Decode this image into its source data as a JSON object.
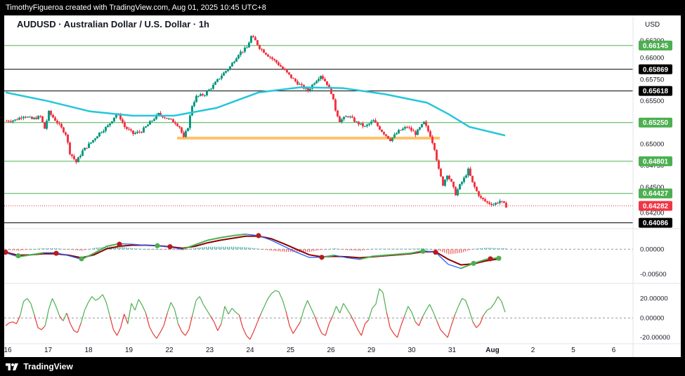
{
  "header": {
    "credit": "TimothyFigueroa created with TradingView.com, Aug 01, 2025 10:45 UTC+8"
  },
  "footer": {
    "brand": "TradingView"
  },
  "chart_data": {
    "type": "candlestick",
    "title": "AUDUSD · Australian Dollar / U.S. Dollar · 1h",
    "currency": "USD",
    "x_tick_labels": [
      "16",
      "17",
      "18",
      "19",
      "22",
      "23",
      "24",
      "25",
      "26",
      "29",
      "30",
      "31",
      "Aug",
      "2",
      "5",
      "6"
    ],
    "price_axis": {
      "labels": [
        "0.66200",
        "0.66000",
        "0.65750",
        "0.65500",
        "0.65250",
        "0.65000",
        "0.64750",
        "0.64500",
        "0.64200"
      ],
      "ylim": [
        0.6405,
        0.6625
      ]
    },
    "levels": [
      {
        "value": 0.66145,
        "label": "0.66145",
        "color": "#4caf50"
      },
      {
        "value": 0.65869,
        "label": "0.65869",
        "color": "#000000"
      },
      {
        "value": 0.65618,
        "label": "0.65618",
        "color": "#000000"
      },
      {
        "value": 0.6525,
        "label": "0.65250",
        "color": "#4caf50"
      },
      {
        "value": 0.64801,
        "label": "0.64801",
        "color": "#4caf50"
      },
      {
        "value": 0.64427,
        "label": "0.64427",
        "color": "#4caf50"
      },
      {
        "value": 0.64282,
        "label": "0.64282",
        "color": "#f23645",
        "dotted": true
      },
      {
        "value": 0.64086,
        "label": "0.64086",
        "color": "#000000"
      }
    ],
    "support_zone": {
      "value": 0.6507,
      "color": "#ffb74d"
    },
    "price_path": [
      [
        0,
        0.6527
      ],
      [
        4,
        0.6528
      ],
      [
        8,
        0.6533
      ],
      [
        12,
        0.6529
      ],
      [
        16,
        0.6532
      ],
      [
        18,
        0.6518
      ],
      [
        20,
        0.6537
      ],
      [
        24,
        0.6525
      ],
      [
        28,
        0.6512
      ],
      [
        30,
        0.649
      ],
      [
        33,
        0.6479
      ],
      [
        36,
        0.6492
      ],
      [
        40,
        0.6502
      ],
      [
        44,
        0.6513
      ],
      [
        48,
        0.6521
      ],
      [
        52,
        0.6535
      ],
      [
        54,
        0.653
      ],
      [
        56,
        0.652
      ],
      [
        60,
        0.6512
      ],
      [
        64,
        0.6515
      ],
      [
        68,
        0.6525
      ],
      [
        72,
        0.6535
      ],
      [
        76,
        0.653
      ],
      [
        80,
        0.6525
      ],
      [
        82,
        0.652
      ],
      [
        84,
        0.6507
      ],
      [
        86,
        0.652
      ],
      [
        88,
        0.6545
      ],
      [
        90,
        0.6555
      ],
      [
        94,
        0.6558
      ],
      [
        98,
        0.6568
      ],
      [
        102,
        0.658
      ],
      [
        106,
        0.659
      ],
      [
        110,
        0.6605
      ],
      [
        114,
        0.6612
      ],
      [
        116,
        0.6625
      ],
      [
        118,
        0.662
      ],
      [
        120,
        0.6612
      ],
      [
        124,
        0.6603
      ],
      [
        128,
        0.6595
      ],
      [
        132,
        0.6585
      ],
      [
        136,
        0.6575
      ],
      [
        140,
        0.6567
      ],
      [
        143,
        0.6562
      ],
      [
        146,
        0.6572
      ],
      [
        149,
        0.658
      ],
      [
        152,
        0.657
      ],
      [
        154,
        0.656
      ],
      [
        156,
        0.654
      ],
      [
        158,
        0.6527
      ],
      [
        162,
        0.6533
      ],
      [
        166,
        0.6525
      ],
      [
        170,
        0.652
      ],
      [
        174,
        0.6527
      ],
      [
        178,
        0.6515
      ],
      [
        182,
        0.6505
      ],
      [
        186,
        0.6515
      ],
      [
        190,
        0.652
      ],
      [
        194,
        0.6512
      ],
      [
        198,
        0.6525
      ],
      [
        201,
        0.651
      ],
      [
        203,
        0.6495
      ],
      [
        205,
        0.647
      ],
      [
        207,
        0.6453
      ],
      [
        209,
        0.6465
      ],
      [
        211,
        0.6455
      ],
      [
        213,
        0.6442
      ],
      [
        215,
        0.6452
      ],
      [
        217,
        0.646
      ],
      [
        219,
        0.647
      ],
      [
        221,
        0.6455
      ],
      [
        223,
        0.6445
      ],
      [
        225,
        0.6437
      ],
      [
        228,
        0.6432
      ],
      [
        231,
        0.643
      ],
      [
        234,
        0.6434
      ],
      [
        237,
        0.6428
      ]
    ],
    "ma_path": [
      [
        0,
        0.656
      ],
      [
        20,
        0.655
      ],
      [
        40,
        0.6538
      ],
      [
        60,
        0.6533
      ],
      [
        80,
        0.6533
      ],
      [
        100,
        0.6542
      ],
      [
        120,
        0.656
      ],
      [
        140,
        0.6566
      ],
      [
        160,
        0.6565
      ],
      [
        180,
        0.6558
      ],
      [
        200,
        0.6548
      ],
      [
        210,
        0.6535
      ],
      [
        220,
        0.652
      ],
      [
        237,
        0.651
      ]
    ],
    "osc1": {
      "labels": [
        "0.00000",
        "-0.00500"
      ],
      "ylim": [
        -0.0065,
        0.0038
      ],
      "fast": [
        [
          0,
          -0.0007
        ],
        [
          6,
          -0.0015
        ],
        [
          12,
          -0.0011
        ],
        [
          18,
          -0.0007
        ],
        [
          24,
          -0.0007
        ],
        [
          30,
          -0.0013
        ],
        [
          36,
          -0.002
        ],
        [
          42,
          -0.0008
        ],
        [
          48,
          0.0006
        ],
        [
          54,
          0.0011
        ],
        [
          60,
          0.001
        ],
        [
          66,
          0.0008
        ],
        [
          72,
          0.0007
        ],
        [
          78,
          0.0004
        ],
        [
          84,
          0.0
        ],
        [
          90,
          0.0009
        ],
        [
          96,
          0.0018
        ],
        [
          102,
          0.0023
        ],
        [
          108,
          0.0027
        ],
        [
          114,
          0.003
        ],
        [
          120,
          0.0027
        ],
        [
          126,
          0.0018
        ],
        [
          132,
          0.0006
        ],
        [
          138,
          -0.0006
        ],
        [
          144,
          -0.0016
        ],
        [
          150,
          -0.0016
        ],
        [
          156,
          -0.0012
        ],
        [
          162,
          -0.0017
        ],
        [
          168,
          -0.002
        ],
        [
          174,
          -0.0014
        ],
        [
          180,
          -0.0012
        ],
        [
          186,
          -0.001
        ],
        [
          192,
          -0.0008
        ],
        [
          198,
          -0.0003
        ],
        [
          204,
          -0.0006
        ],
        [
          210,
          -0.003
        ],
        [
          216,
          -0.0038
        ],
        [
          222,
          -0.0028
        ],
        [
          228,
          -0.002
        ],
        [
          234,
          -0.0017
        ]
      ],
      "slow": [
        [
          0,
          -0.0006
        ],
        [
          6,
          -0.0012
        ],
        [
          12,
          -0.0011
        ],
        [
          18,
          -0.0009
        ],
        [
          24,
          -0.0009
        ],
        [
          30,
          -0.0012
        ],
        [
          36,
          -0.0017
        ],
        [
          42,
          -0.0011
        ],
        [
          48,
          0.0001
        ],
        [
          54,
          0.0006
        ],
        [
          60,
          0.0008
        ],
        [
          66,
          0.0008
        ],
        [
          72,
          0.0007
        ],
        [
          78,
          0.0005
        ],
        [
          84,
          0.0002
        ],
        [
          90,
          0.0006
        ],
        [
          96,
          0.0013
        ],
        [
          102,
          0.0018
        ],
        [
          108,
          0.0022
        ],
        [
          114,
          0.0026
        ],
        [
          120,
          0.0026
        ],
        [
          126,
          0.0021
        ],
        [
          132,
          0.0011
        ],
        [
          138,
          0.0
        ],
        [
          144,
          -0.0011
        ],
        [
          150,
          -0.0015
        ],
        [
          156,
          -0.0014
        ],
        [
          162,
          -0.0015
        ],
        [
          168,
          -0.0017
        ],
        [
          174,
          -0.0015
        ],
        [
          180,
          -0.0013
        ],
        [
          186,
          -0.0011
        ],
        [
          192,
          -0.0009
        ],
        [
          198,
          -0.0005
        ],
        [
          204,
          -0.0005
        ],
        [
          210,
          -0.002
        ],
        [
          216,
          -0.0031
        ],
        [
          222,
          -0.0029
        ],
        [
          228,
          -0.0023
        ],
        [
          234,
          -0.0019
        ]
      ],
      "cross_up": [
        [
          6,
          -0.0013
        ],
        [
          36,
          -0.0019
        ],
        [
          72,
          0.0007
        ],
        [
          198,
          -0.0004
        ],
        [
          222,
          -0.0028
        ],
        [
          234,
          -0.0018
        ]
      ],
      "cross_down": [
        [
          0,
          -0.0006
        ],
        [
          24,
          -0.0008
        ],
        [
          54,
          0.001
        ],
        [
          78,
          0.0005
        ],
        [
          120,
          0.0027
        ],
        [
          150,
          -0.0016
        ],
        [
          204,
          -0.0006
        ],
        [
          230,
          -0.0019
        ]
      ]
    },
    "osc2": {
      "labels": [
        "20.00000",
        "0.00000",
        "-20.00000"
      ],
      "ylim": [
        -25,
        34
      ],
      "values": [
        -8,
        -5,
        -4,
        -6,
        2,
        17,
        20,
        15,
        3,
        -10,
        -12,
        -8,
        9,
        20,
        12,
        2,
        -3,
        5,
        -6,
        -13,
        -15,
        -5,
        8,
        16,
        22,
        18,
        20,
        24,
        16,
        2,
        -12,
        -18,
        -10,
        4,
        -6,
        15,
        8,
        19,
        13,
        5,
        -9,
        -16,
        -21,
        -15,
        -8,
        5,
        16,
        9,
        -6,
        -14,
        -18,
        -12,
        3,
        18,
        22,
        14,
        8,
        2,
        -4,
        -13,
        -6,
        12,
        4,
        10,
        6,
        3,
        -10,
        -18,
        -22,
        -14,
        -5,
        4,
        12,
        20,
        25,
        28,
        27,
        19,
        7,
        -8,
        -16,
        -10,
        -4,
        9,
        18,
        10,
        2,
        -8,
        -16,
        -18,
        -6,
        2,
        12,
        5,
        15,
        9,
        3,
        -4,
        -12,
        -18,
        -6,
        -2,
        10,
        14,
        30,
        26,
        6,
        -10,
        -16,
        -20,
        -8,
        2,
        12,
        6,
        -4,
        -8,
        1,
        8,
        14,
        6,
        -3,
        -12,
        -16,
        -20,
        -8,
        3,
        12,
        20,
        18,
        8,
        -4,
        -10,
        -6,
        3,
        8,
        10,
        15,
        22,
        17,
        6
      ]
    }
  }
}
